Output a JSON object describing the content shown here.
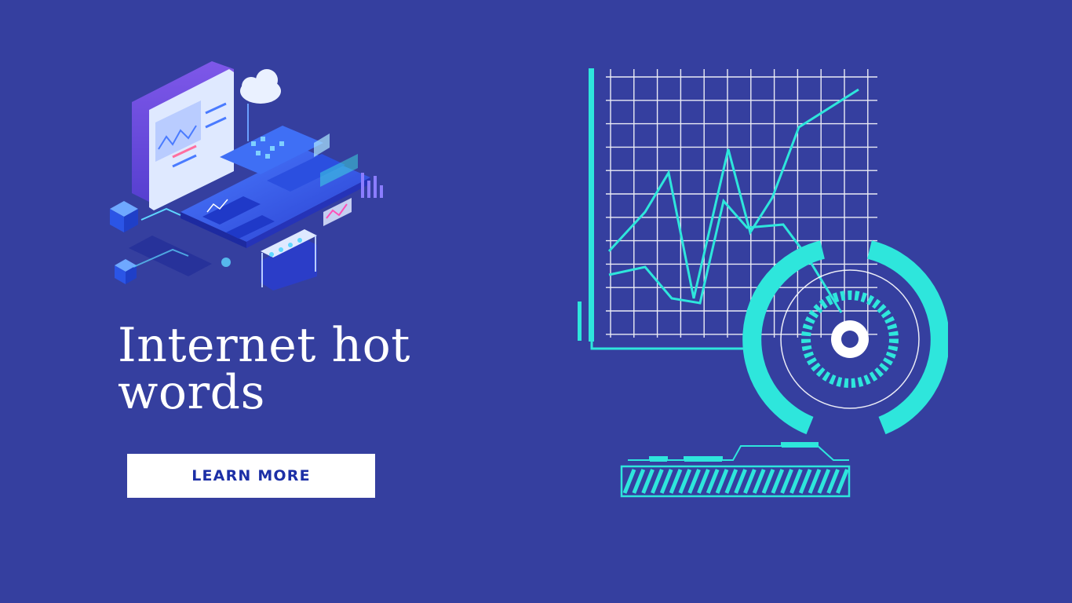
{
  "hero": {
    "headline": "Internet hot words",
    "cta_label": "LEARN MORE"
  },
  "colors": {
    "background": "#353f9f",
    "accent_cyan": "#2ee6dc",
    "button_bg": "#ffffff",
    "button_text": "#1c2fa6",
    "headline": "#ffffff"
  },
  "icons": [
    "cloud-icon",
    "cube-icon",
    "server-icon",
    "dial-icon"
  ]
}
